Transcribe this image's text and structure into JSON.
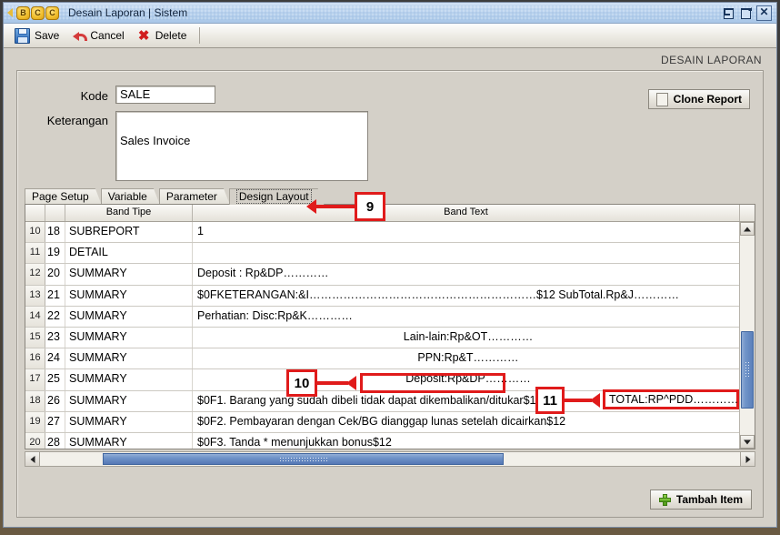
{
  "window": {
    "title": "Desain Laporan | Sistem",
    "logo_letters": [
      "B",
      "C",
      "C"
    ],
    "controls": [
      {
        "name": "restore-button",
        "glyph": "restore"
      },
      {
        "name": "maximize-button",
        "glyph": "maximize"
      },
      {
        "name": "close-button",
        "glyph": "close"
      }
    ]
  },
  "toolbar": {
    "save_label": "Save",
    "cancel_label": "Cancel",
    "delete_label": "Delete"
  },
  "page": {
    "heading": "DESAIN LAPORAN"
  },
  "form": {
    "kode_label": "Kode",
    "kode_value": "SALE",
    "keterangan_label": "Keterangan",
    "keterangan_value": "Sales Invoice",
    "clone_button_label": "Clone Report"
  },
  "tabs": [
    {
      "label": "Page Setup",
      "active": false
    },
    {
      "label": "Variable",
      "active": false
    },
    {
      "label": "Parameter",
      "active": false
    },
    {
      "label": "Design Layout",
      "active": true
    }
  ],
  "grid": {
    "columns": [
      "",
      "",
      "Band Tipe",
      "Band Text"
    ],
    "rows": [
      {
        "num": "10",
        "idx": "18",
        "band": "SUBREPORT",
        "text": "1",
        "align": "left"
      },
      {
        "num": "11",
        "idx": "19",
        "band": "DETAIL",
        "text": "",
        "align": "left"
      },
      {
        "num": "12",
        "idx": "20",
        "band": "SUMMARY",
        "text": "Deposit : Rp&DP…………",
        "align": "left"
      },
      {
        "num": "13",
        "idx": "21",
        "band": "SUMMARY",
        "text": "$0FKETERANGAN:&I……………………………………………………$12  SubTotal.Rp&J…………",
        "align": "left"
      },
      {
        "num": "14",
        "idx": "22",
        "band": "SUMMARY",
        "text": "Perhatian:                             Disc:Rp&K…………",
        "align": "left"
      },
      {
        "num": "15",
        "idx": "23",
        "band": "SUMMARY",
        "text": "Lain-lain:Rp&OT…………",
        "align": "center"
      },
      {
        "num": "16",
        "idx": "24",
        "band": "SUMMARY",
        "text": "PPN:Rp&T…………",
        "align": "center"
      },
      {
        "num": "17",
        "idx": "25",
        "band": "SUMMARY",
        "text": "Deposit:Rp&DP…………",
        "align": "center"
      },
      {
        "num": "18",
        "idx": "26",
        "band": "SUMMARY",
        "text": "$0F1. Barang yang sudah dibeli tidak dapat dikembalikan/ditukar$12",
        "align": "left"
      },
      {
        "num": "19",
        "idx": "27",
        "band": "SUMMARY",
        "text": "$0F2. Pembayaran dengan Cek/BG dianggap lunas setelah dicairkan$12",
        "align": "left"
      },
      {
        "num": "20",
        "idx": "28",
        "band": "SUMMARY",
        "text": "$0F3. Tanda * menunjukkan bonus$12",
        "align": "left"
      }
    ]
  },
  "overlay_text": {
    "total_field": "TOTAL:RP^PDD…………"
  },
  "footer": {
    "tambah_item_label": "Tambah Item"
  },
  "annotations": [
    {
      "id": "9",
      "label": "9"
    },
    {
      "id": "10",
      "label": "10"
    },
    {
      "id": "11",
      "label": "11"
    }
  ],
  "colors": {
    "annotation_red": "#e01b1b",
    "titlebar_blue": "#b9d2ee",
    "scrollbar_blue": "#5b80bb",
    "window_face": "#d4d0c8"
  }
}
